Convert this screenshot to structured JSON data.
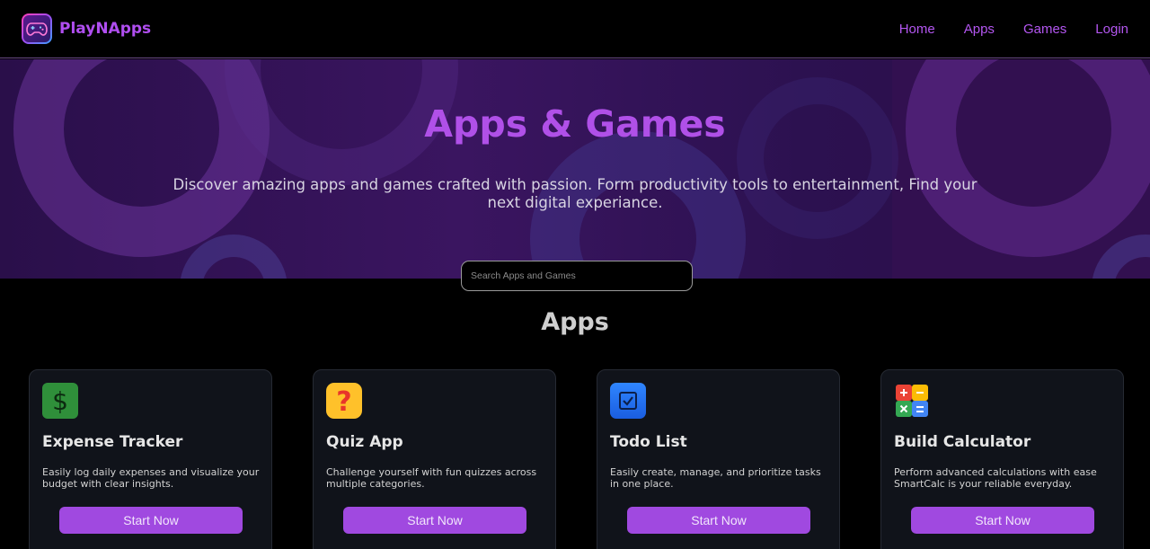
{
  "brand": {
    "name": "PlayNApps",
    "logo_icon": "gamepad-icon"
  },
  "nav": {
    "items": [
      {
        "label": "Home"
      },
      {
        "label": "Apps"
      },
      {
        "label": "Games"
      },
      {
        "label": "Login"
      }
    ]
  },
  "hero": {
    "title": "Apps & Games",
    "subtitle": "Discover amazing apps and games crafted with passion. Form productivity tools to entertainment, Find your next digital experiance."
  },
  "search": {
    "placeholder": "Search Apps and Games",
    "value": ""
  },
  "section": {
    "title": "Apps"
  },
  "cards": [
    {
      "icon": "dollar-icon",
      "title": "Expense Tracker",
      "description": "Easily log daily expenses and visualize your budget with clear insights.",
      "button": "Start Now"
    },
    {
      "icon": "question-icon",
      "title": "Quiz App",
      "description": "Challenge yourself with fun quizzes across multiple categories.",
      "button": "Start Now"
    },
    {
      "icon": "checkbox-icon",
      "title": "Todo List",
      "description": "Easily create, manage, and prioritize tasks in one place.",
      "button": "Start Now"
    },
    {
      "icon": "calculator-icon",
      "title": "Build Calculator",
      "description": "Perform advanced calculations with ease SmartCalc is your reliable everyday.",
      "button": "Start Now"
    }
  ],
  "colors": {
    "accent": "#a049e0",
    "brand": "#b04ef0",
    "hero_bg": "#2a0f4a",
    "card_bg": "#10131a"
  }
}
